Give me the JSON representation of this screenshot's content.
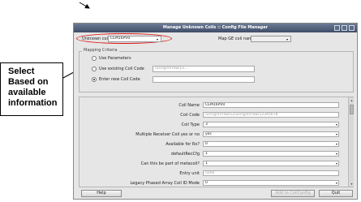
{
  "callout": {
    "lines": [
      "Select",
      "Based on",
      "available",
      "information"
    ]
  },
  "window": {
    "title": "Manage Unknown Coils :: Config File Manager",
    "unknown_coil_label": "Unknown coil",
    "unknown_coil_value": "CEM16PV0",
    "map_ge_label": "Map GE coil name",
    "map_ge_value": "",
    "mapping_group_title": "Mapping Criteria",
    "radio_options": [
      {
        "label": "Use Parameters",
        "selected": false
      },
      {
        "label": "Use existing Coil Code",
        "selected": false,
        "value": "/usr/g/mrraw/12..."
      },
      {
        "label": "Enter new Coil Code",
        "selected": true,
        "value": ""
      }
    ],
    "properties": [
      {
        "label": "Coil Name",
        "value": "CEM16PV0",
        "type": "text"
      },
      {
        "label": "Coil Code",
        "value": "/usr/g/mrraw/12/usr/g/mrraw/12345678",
        "type": "text-grey"
      },
      {
        "label": "Coil Type",
        "value": "3",
        "type": "select"
      },
      {
        "label": "Multiple Receiver Coil yes or no",
        "value": "yes",
        "type": "select"
      },
      {
        "label": "Available for Rx?",
        "value": "0",
        "type": "select"
      },
      {
        "label": "defaultRecCfg",
        "value": "1",
        "type": "select"
      },
      {
        "label": "Can this be part of metacoil?",
        "value": "1",
        "type": "select"
      },
      {
        "label": "Entry unit",
        "value": "none",
        "type": "text-grey"
      },
      {
        "label": "Legacy Phased Array Coil ID Mode",
        "value": "0",
        "type": "select"
      }
    ],
    "buttons": {
      "help": "Help",
      "add": "Add to CoilConfig",
      "quit": "Quit"
    },
    "icons": {
      "dropdown": "▾",
      "scroll_up": "▴",
      "scroll_down": "▾"
    }
  }
}
